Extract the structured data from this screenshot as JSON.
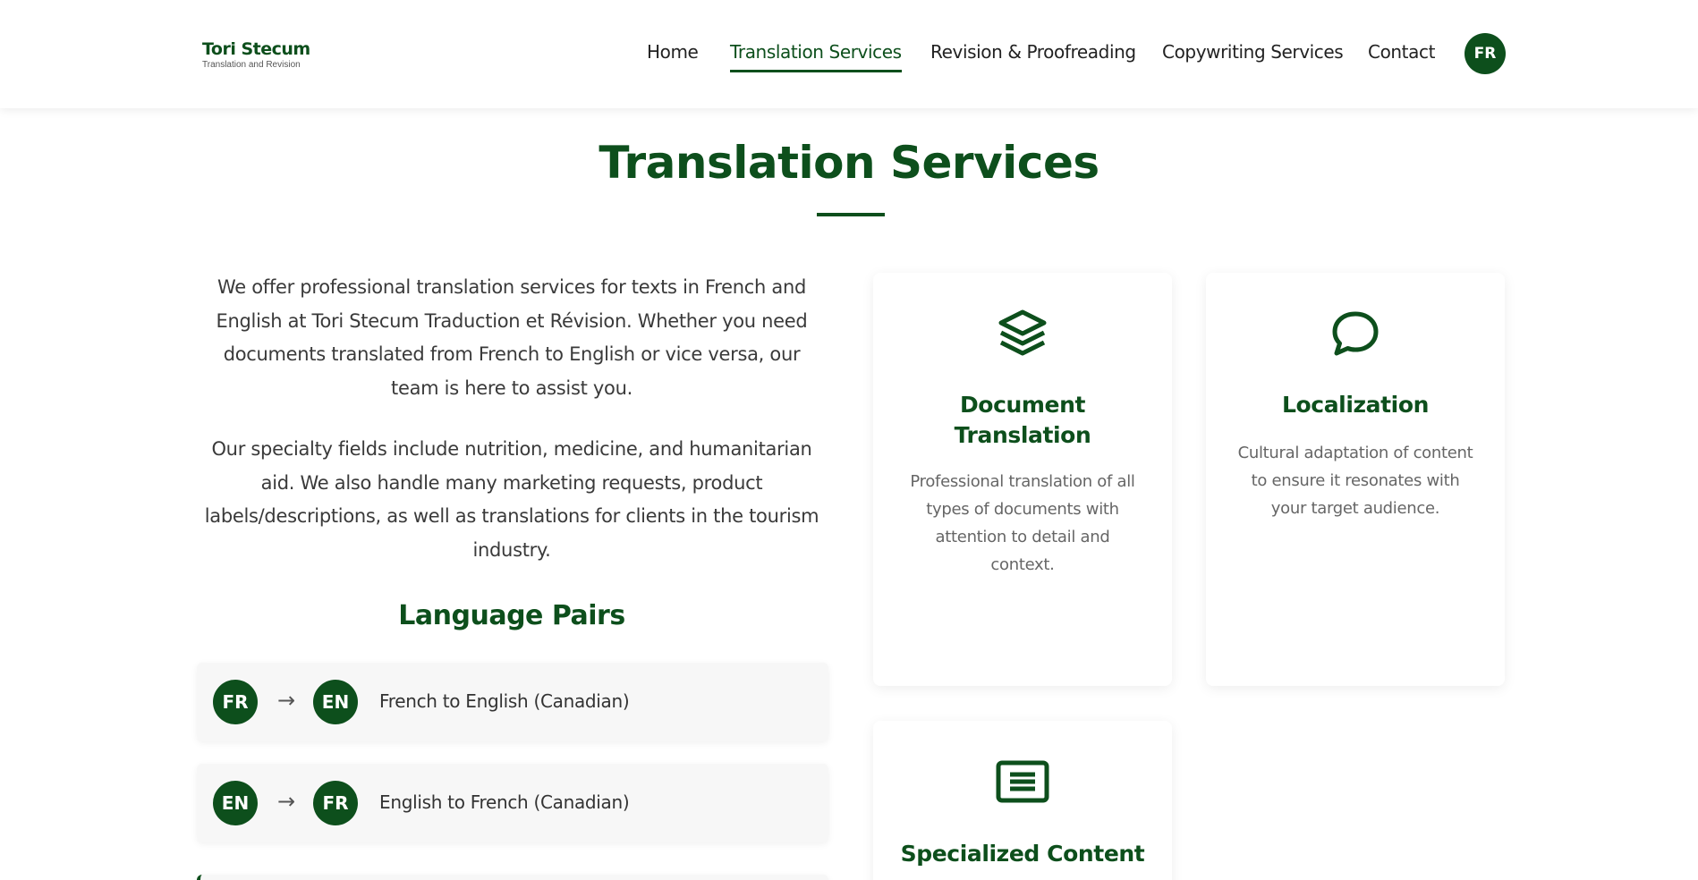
{
  "brand": {
    "name": "Tori Stecum",
    "tagline": "Translation and Revision",
    "accent_color": "#0d4f1c"
  },
  "nav": {
    "items": [
      {
        "label": "Home",
        "active": false
      },
      {
        "label": "Translation Services",
        "active": true
      },
      {
        "label": "Revision & Proofreading",
        "active": false
      },
      {
        "label": "Copywriting Services",
        "active": false
      },
      {
        "label": "Contact",
        "active": false
      }
    ],
    "language_toggle": "FR"
  },
  "page": {
    "title": "Translation Services",
    "intro_paragraphs": [
      "We offer professional translation services for texts in French and English at Tori Stecum Traduction et Révision. Whether you need documents translated from French to English or vice versa, our team is here to assist you.",
      "Our specialty fields include nutrition, medicine, and humanitarian aid. We also handle many marketing requests, product labels/descriptions, as well as translations for clients in the tourism industry."
    ]
  },
  "language_pairs": {
    "heading": "Language Pairs",
    "arrow": "→",
    "items": [
      {
        "from": "FR",
        "to": "EN",
        "label": "French to English (Canadian)"
      },
      {
        "from": "EN",
        "to": "FR",
        "label": "English to French (Canadian)"
      }
    ]
  },
  "services": [
    {
      "icon": "layers-icon",
      "title": "Document Translation",
      "description": "Professional translation of all types of documents with attention to detail and context."
    },
    {
      "icon": "speech-bubble-icon",
      "title": "Localization",
      "description": "Cultural adaptation of content to ensure it resonates with your target audience."
    },
    {
      "icon": "text-box-icon",
      "title": "Specialized Content",
      "description": ""
    }
  ]
}
